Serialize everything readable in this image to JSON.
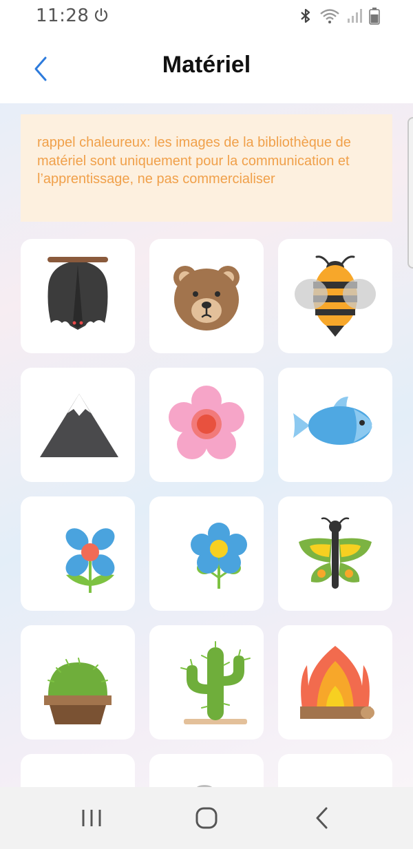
{
  "status_bar": {
    "time": "11:28",
    "icons": [
      "power-icon",
      "bluetooth-icon",
      "wifi-icon",
      "signal-icon",
      "battery-icon"
    ]
  },
  "header": {
    "title": "Matériel",
    "back_icon": "chevron-left-icon",
    "accent_color": "#2d7bdc"
  },
  "notice": {
    "text": "rappel chaleureux: les images de la bibliothèque de matériel sont uniquement pour la communication et l’apprentissage, ne pas commercialiser",
    "text_color": "#f0a04a",
    "background": "#fdf0df"
  },
  "materials": [
    {
      "icon": "bat-icon"
    },
    {
      "icon": "bear-icon"
    },
    {
      "icon": "bee-icon"
    },
    {
      "icon": "mountain-icon"
    },
    {
      "icon": "pink-flower-icon"
    },
    {
      "icon": "fish-icon"
    },
    {
      "icon": "blue-flower-icon"
    },
    {
      "icon": "daisy-icon"
    },
    {
      "icon": "butterfly-icon"
    },
    {
      "icon": "potted-cactus-icon"
    },
    {
      "icon": "desert-cactus-icon"
    },
    {
      "icon": "campfire-icon"
    }
  ],
  "nav_bar": {
    "buttons": [
      "recent-apps-icon",
      "home-icon",
      "back-icon"
    ]
  }
}
